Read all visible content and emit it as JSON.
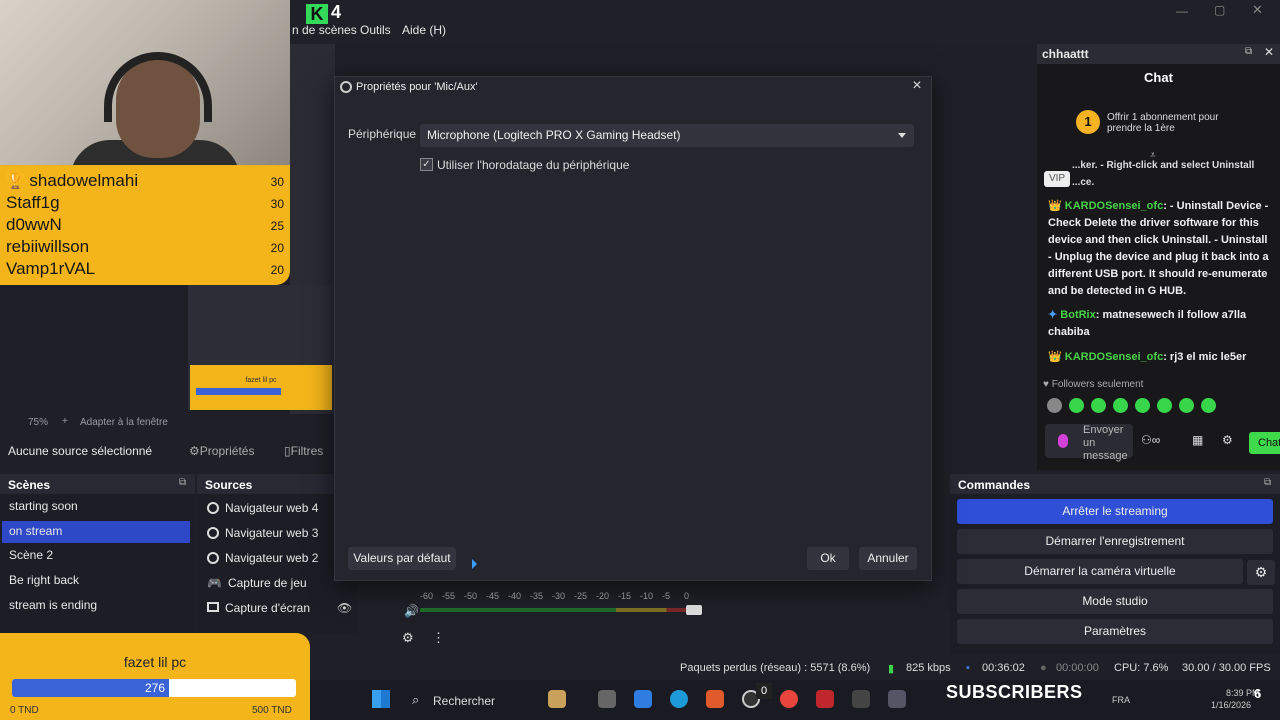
{
  "app": {
    "logo_letter": "K",
    "logo_number": "4"
  },
  "menu": {
    "scenes_partial": "n de scènes",
    "tools": "Outils",
    "help": "Aide (H)"
  },
  "leaderboard": [
    {
      "name": "shadowelmahi",
      "score": "30"
    },
    {
      "name": "Staff1g",
      "score": "30"
    },
    {
      "name": "d0wwN",
      "score": "25"
    },
    {
      "name": "rebiiwillson",
      "score": "20"
    },
    {
      "name": "Vamp1rVAL",
      "score": "20"
    }
  ],
  "preview": {
    "zoom": "75%",
    "fit": "Adapter à la fenêtre",
    "mini_bar_label": "fazet lil pc"
  },
  "source_toolbar": {
    "no_source": "Aucune source sélectionné",
    "properties": "Propriétés",
    "filters": "Filtres"
  },
  "scenes": {
    "title": "Scènes",
    "items": [
      "starting soon",
      "on stream",
      "Scène 2",
      "Be right back",
      "stream is ending"
    ],
    "active_index": 1
  },
  "sources": {
    "title": "Sources",
    "items": [
      "Navigateur web 4",
      "Navigateur web 3",
      "Navigateur web 2",
      "Capture de jeu",
      "Capture d'écran"
    ]
  },
  "commands": {
    "title": "Commandes",
    "stop_streaming": "Arrêter le streaming",
    "start_recording": "Démarrer l'enregistrement",
    "start_virtual_cam": "Démarrer la caméra virtuelle",
    "studio_mode": "Mode studio",
    "settings": "Paramètres"
  },
  "chat": {
    "window_title": "chhaattt",
    "title": "Chat",
    "gift_badge": "1",
    "gift_text": "Offrir 1 abonnement pour prendre la 1ère",
    "top_fragment": "...ker. - Right-click and select Uninstall ...ce.",
    "vip": "VIP",
    "messages": [
      {
        "user": "KARDOSensei_ofc",
        "text": ": - Uninstall Device - Check Delete the driver software for this device and then click Uninstall. - Uninstall - Unplug the device and plug it back into a different USB port. It should re-enumerate and be detected in G HUB."
      },
      {
        "user": "BotRix",
        "text": ": matnesewech il follow a7lla chabiba"
      },
      {
        "user": "KARDOSensei_ofc",
        "text": ": rj3 el mic le5er"
      }
    ],
    "followers_only": "Followers seulement",
    "input_placeholder": "Envoyer un message",
    "send": "Chat"
  },
  "modal": {
    "title": "Propriétés pour 'Mic/Aux'",
    "device_label": "Périphérique",
    "device_value": "Microphone (Logitech PRO X Gaming Headset)",
    "use_timestamps": "Utiliser l'horodatage du périphérique",
    "use_timestamps_checked": true,
    "defaults": "Valeurs par défaut",
    "ok": "Ok",
    "cancel": "Annuler"
  },
  "audio_meter": {
    "ticks": [
      "-60",
      "-55",
      "-50",
      "-45",
      "-40",
      "-35",
      "-30",
      "-25",
      "-20",
      "-15",
      "-10",
      "-5",
      "0"
    ]
  },
  "donation": {
    "title": "fazet lil pc",
    "value": "276",
    "min": "0 TND",
    "max": "500 TND",
    "fraction": 0.552
  },
  "status_bar": {
    "dropped": "Paquets perdus (réseau) : 5571 (8.6%)",
    "bitrate": "825 kbps",
    "live_time": "00:36:02",
    "rec_time": "00:00:00",
    "cpu": "CPU: 7.6%",
    "fps": "30.00 / 30.00 FPS"
  },
  "taskbar": {
    "search": "Rechercher",
    "subscribers_label": "SUBSCRIBERS",
    "subscribers_count": "6",
    "badge": "0",
    "lang": "FRA",
    "time": "8:39 PM",
    "date": "1/16/2026"
  }
}
